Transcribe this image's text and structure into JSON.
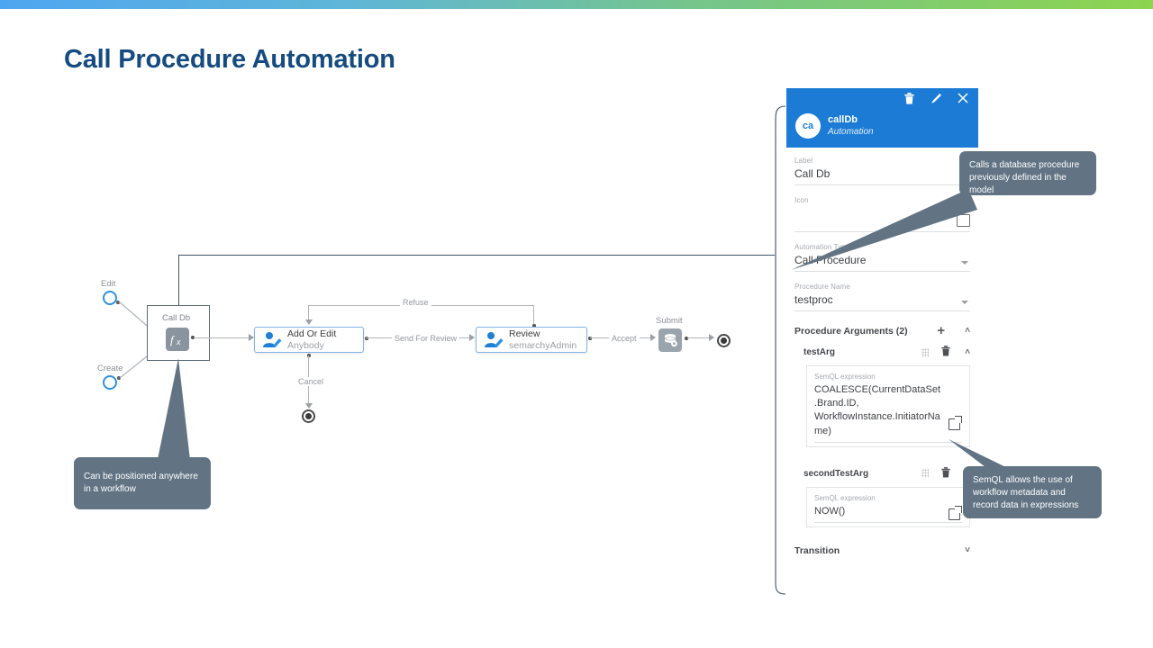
{
  "slide": {
    "title": "Call Procedure Automation",
    "title_color": "#154B80",
    "accent_gradient_from": "#4FA6F0",
    "accent_gradient_to": "#8DD44F"
  },
  "workflow": {
    "start_nodes": [
      {
        "label": "Edit"
      },
      {
        "label": "Create"
      }
    ],
    "automation_node": {
      "label": "Call Db",
      "icon": "function-fx-icon"
    },
    "tasks": [
      {
        "name": "Add Or Edit",
        "assignee": "Anybody",
        "icon": "user-edit-icon"
      },
      {
        "name": "Review",
        "assignee": "semarchyAdmin",
        "icon": "user-edit-icon"
      }
    ],
    "submit_node": {
      "label": "Submit",
      "icon": "database-submit-icon"
    },
    "transitions": [
      {
        "label": "Refuse"
      },
      {
        "label": "Send For Review"
      },
      {
        "label": "Cancel"
      },
      {
        "label": "Accept"
      }
    ]
  },
  "panel": {
    "header": {
      "avatar_initials": "ca",
      "name": "callDb",
      "subtitle": "Automation",
      "icons": [
        {
          "name": "delete-icon",
          "glyph": "🗑"
        },
        {
          "name": "edit-icon",
          "glyph": "✎"
        },
        {
          "name": "close-icon",
          "glyph": "×"
        }
      ],
      "background": "#1C7CD5"
    },
    "fields": [
      {
        "label": "Label",
        "value": "Call Db"
      },
      {
        "label": "Icon",
        "value": ""
      },
      {
        "label": "Automation Type",
        "value": "Call Procedure"
      },
      {
        "label": "Procedure Name",
        "value": "testproc"
      }
    ],
    "arguments_section": {
      "title": "Procedure Arguments (2)",
      "add_label": "+",
      "collapse_label": "˄"
    },
    "arguments": [
      {
        "name": "testArg",
        "expression_label": "SemQL expression",
        "expression": "COALESCE(CurrentDataSet.Brand.ID, WorkflowInstance.InitiatorName)"
      },
      {
        "name": "secondTestArg",
        "expression_label": "SemQL expression",
        "expression": "NOW()"
      }
    ],
    "transition": {
      "title": "Transition",
      "expand_label": "˅"
    }
  },
  "callouts": [
    {
      "id": "callout-automation-type",
      "text": "Calls a database procedure previously defined in the model"
    },
    {
      "id": "callout-semql",
      "text": "SemQL allows the use of workflow  metadata and record data in expressions"
    },
    {
      "id": "callout-position",
      "text": "Can be positioned anywhere in a workflow"
    }
  ]
}
